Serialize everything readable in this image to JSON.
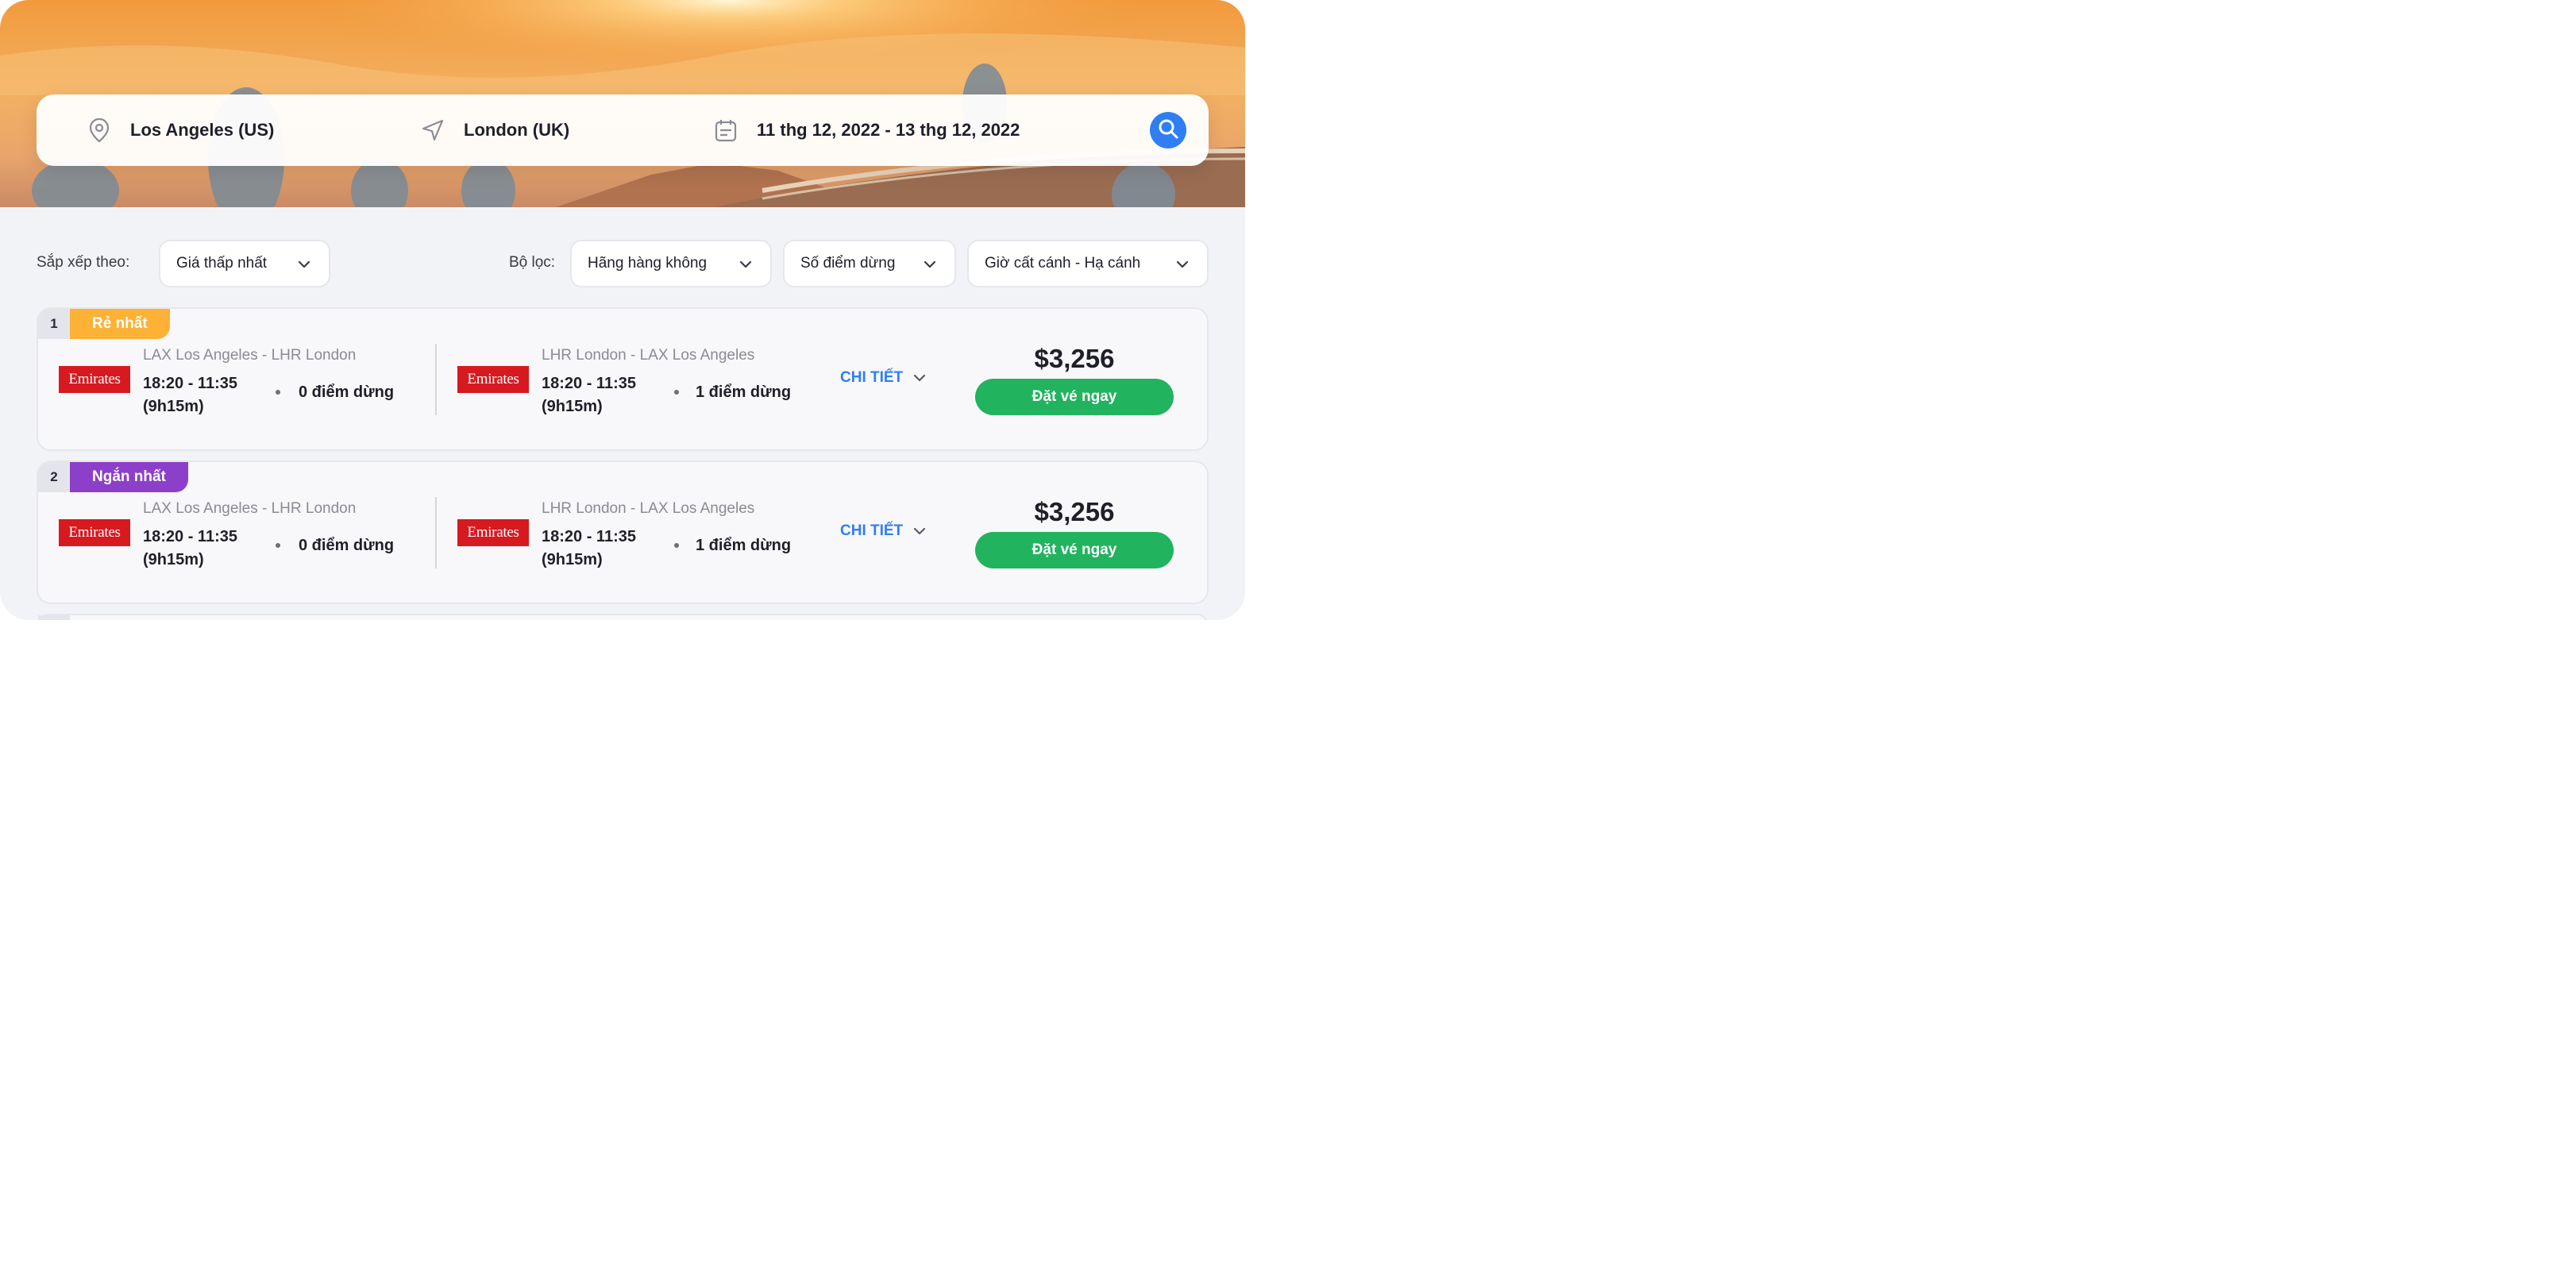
{
  "search": {
    "origin": "Los Angeles (US)",
    "destination": "London (UK)",
    "dates": "11 thg 12, 2022 - 13 thg 12, 2022",
    "origin_icon": "map-pin-icon",
    "destination_icon": "navigation-arrow-icon",
    "date_icon": "calendar-icon",
    "search_icon": "search-icon"
  },
  "toolbar": {
    "sort_label": "Sắp xếp theo:",
    "sort_value": "Giá thấp nhất",
    "filter_label": "Bộ lọc:",
    "filters": [
      "Hãng hàng không",
      "Số điểm dừng",
      "Giờ cất cánh - Hạ cánh"
    ]
  },
  "results": [
    {
      "rank": "1",
      "tag": "Rẻ nhất",
      "tag_color": "#fdb135",
      "outbound": {
        "airline": "Emirates",
        "route": "LAX Los Angeles - LHR London",
        "time": "18:20 - 11:35",
        "duration": "(9h15m)",
        "stops": "0 điểm dừng"
      },
      "inbound": {
        "airline": "Emirates",
        "route": "LHR London - LAX Los Angeles",
        "time": "18:20 - 11:35",
        "duration": "(9h15m)",
        "stops": "1 điểm dừng"
      },
      "detail_label": "CHI TIẾT",
      "price": "$3,256",
      "book_label": "Đặt vé ngay"
    },
    {
      "rank": "2",
      "tag": "Ngắn nhất",
      "tag_color": "#8c3fc9",
      "outbound": {
        "airline": "Emirates",
        "route": "LAX Los Angeles - LHR London",
        "time": "18:20 - 11:35",
        "duration": "(9h15m)",
        "stops": "0 điểm dừng"
      },
      "inbound": {
        "airline": "Emirates",
        "route": "LHR London - LAX Los Angeles",
        "time": "18:20 - 11:35",
        "duration": "(9h15m)",
        "stops": "1 điểm dừng"
      },
      "detail_label": "CHI TIẾT",
      "price": "$3,256",
      "book_label": "Đặt vé ngay"
    }
  ],
  "colors": {
    "accent": "#2f7ef4",
    "book_button": "#22b35e",
    "airline_logo": "#d71920"
  }
}
